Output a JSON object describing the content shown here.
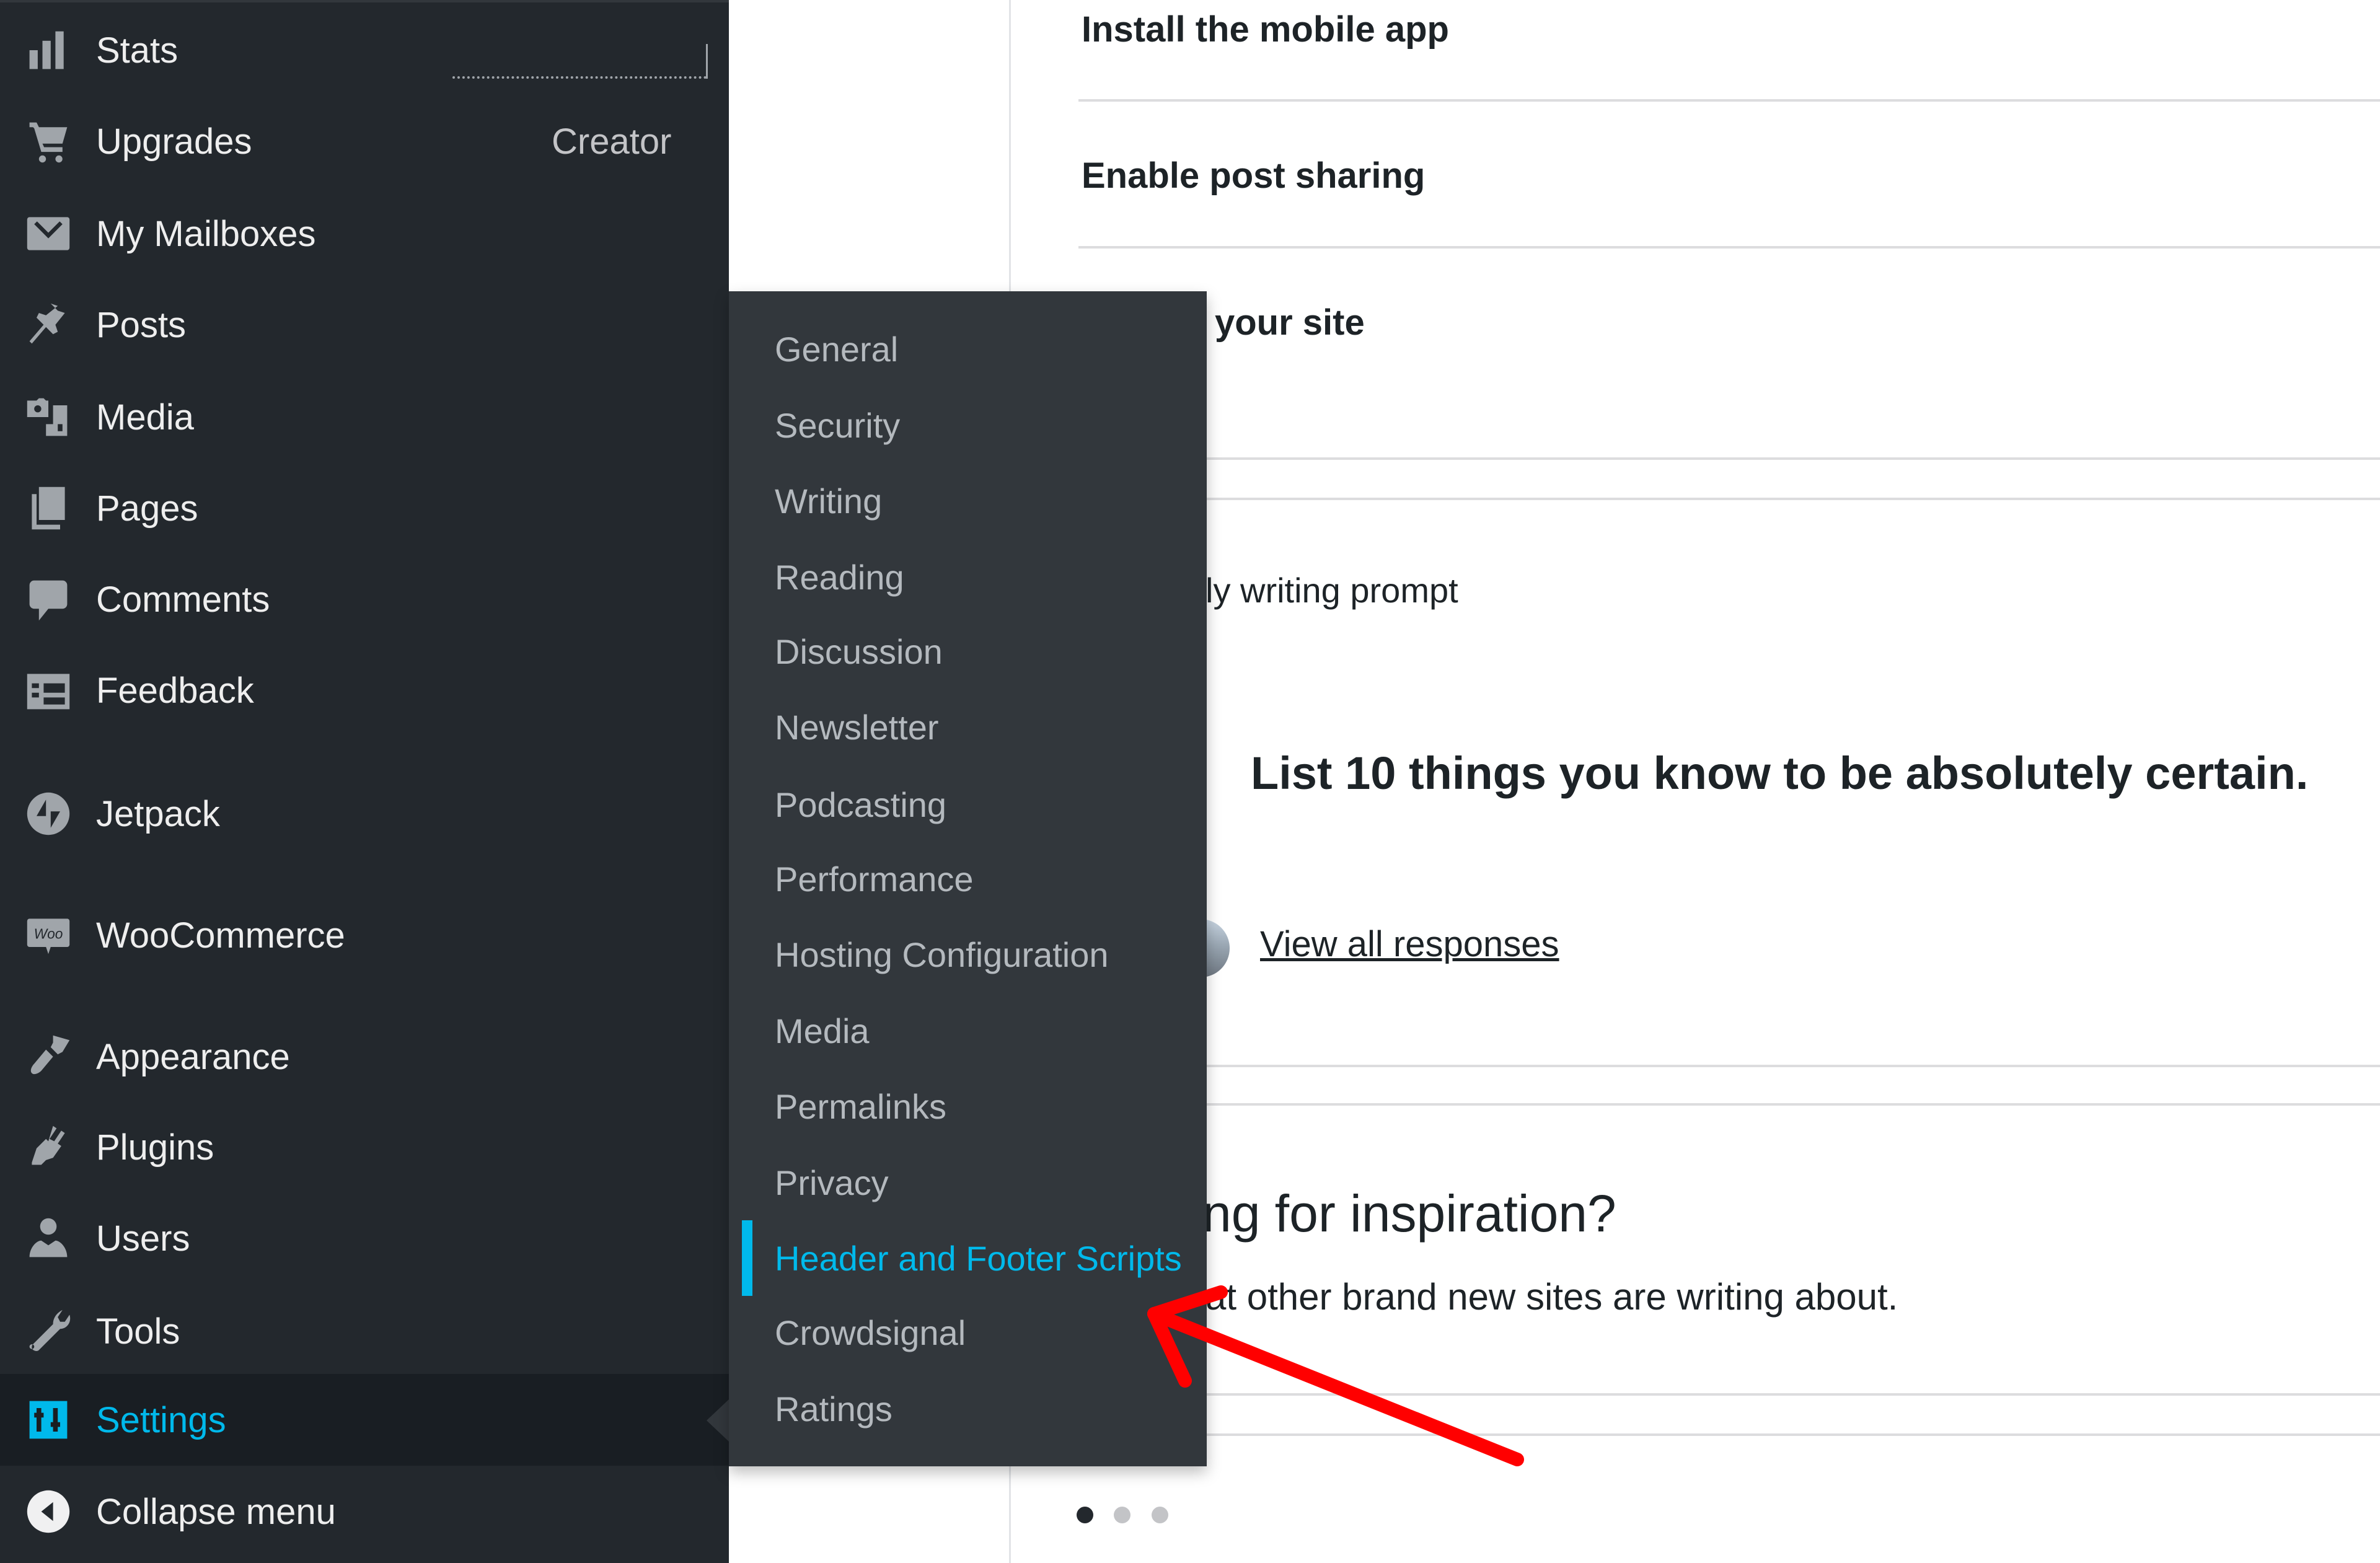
{
  "colors": {
    "sidebar_bg": "#23282d",
    "flyout_bg": "#32373c",
    "active_bg": "#191e23",
    "accent": "#00b9eb",
    "annotation_arrow": "#ff0000",
    "dot_active": "#23282d",
    "dot_inactive": "#c3c4c7"
  },
  "sidebar": {
    "items": [
      {
        "label": "Stats",
        "icon": "bar-chart-icon"
      },
      {
        "label": "Upgrades",
        "icon": "cart-icon",
        "badge": "Creator"
      },
      {
        "label": "My Mailboxes",
        "icon": "mail-icon"
      },
      {
        "label": "Posts",
        "icon": "pushpin-icon"
      },
      {
        "label": "Media",
        "icon": "media-icon"
      },
      {
        "label": "Pages",
        "icon": "pages-icon"
      },
      {
        "label": "Comments",
        "icon": "comment-icon"
      },
      {
        "label": "Feedback",
        "icon": "feedback-icon"
      },
      {
        "label": "Jetpack",
        "icon": "jetpack-icon"
      },
      {
        "label": "WooCommerce",
        "icon": "woo-icon"
      },
      {
        "label": "Appearance",
        "icon": "paintbrush-icon"
      },
      {
        "label": "Plugins",
        "icon": "plug-icon"
      },
      {
        "label": "Users",
        "icon": "user-icon"
      },
      {
        "label": "Tools",
        "icon": "wrench-icon"
      },
      {
        "label": "Settings",
        "icon": "settings-icon",
        "active": true
      },
      {
        "label": "Collapse menu",
        "icon": "collapse-icon"
      }
    ]
  },
  "settings_submenu": {
    "items": [
      {
        "label": "General"
      },
      {
        "label": "Security"
      },
      {
        "label": "Writing"
      },
      {
        "label": "Reading"
      },
      {
        "label": "Discussion"
      },
      {
        "label": "Newsletter"
      },
      {
        "label": "Podcasting"
      },
      {
        "label": "Performance"
      },
      {
        "label": "Hosting Configuration"
      },
      {
        "label": "Media"
      },
      {
        "label": "Permalinks"
      },
      {
        "label": "Privacy"
      },
      {
        "label": "Header and Footer Scripts",
        "current": true
      },
      {
        "label": "Crowdsignal"
      },
      {
        "label": "Ratings"
      }
    ]
  },
  "main": {
    "checklist": [
      {
        "label": "Install the mobile app"
      },
      {
        "label": "Enable post sharing"
      },
      {
        "label": "Name your site",
        "visible_text": "your site"
      }
    ],
    "prompt": {
      "label": "Daily writing prompt",
      "visible_label": "ly writing prompt",
      "text": "List 10 things you know to be absolutely certain.",
      "link": "View all responses"
    },
    "inspiration": {
      "title": "Looking for inspiration?",
      "visible_title": "ng for inspiration?",
      "subtitle": "See what other brand new sites are writing about.",
      "visible_subtitle": "at other brand new sites are writing about."
    },
    "carousel": {
      "pages": 3,
      "current": 1
    }
  }
}
